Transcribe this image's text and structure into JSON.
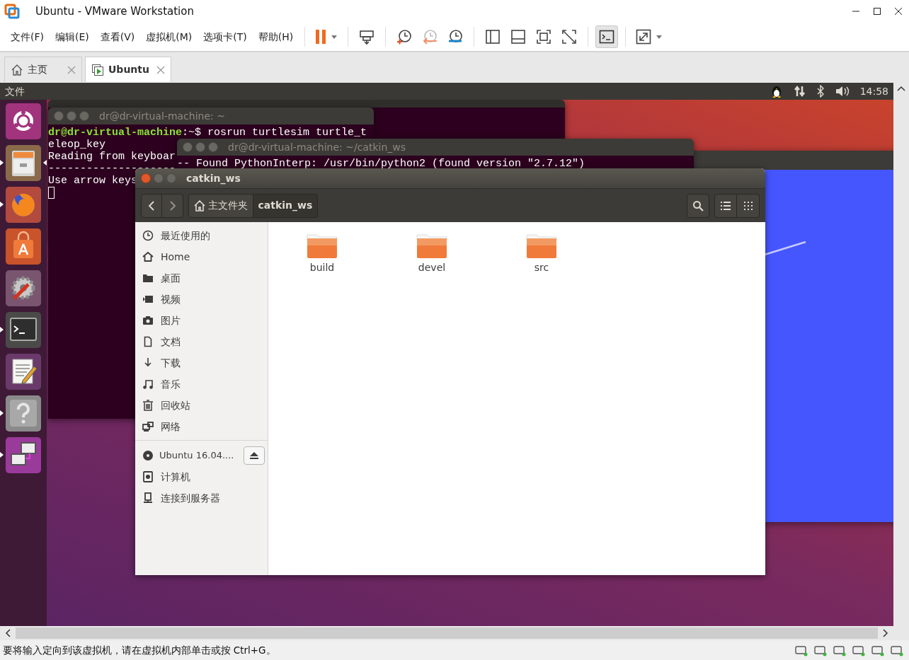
{
  "window": {
    "title": "Ubuntu - VMware Workstation"
  },
  "menu": [
    {
      "label": "文件(F)"
    },
    {
      "label": "编辑(E)"
    },
    {
      "label": "查看(V)"
    },
    {
      "label": "虚拟机(M)"
    },
    {
      "label": "选项卡(T)"
    },
    {
      "label": "帮助(H)"
    }
  ],
  "toolbar": [
    {
      "items": [
        {
          "kind": "pause",
          "pressed": false
        }
      ]
    },
    {
      "items": [
        {
          "kind": "send-keys",
          "pressed": false
        }
      ]
    },
    {
      "items": [
        {
          "kind": "snapshot",
          "pressed": false
        },
        {
          "kind": "revert",
          "pressed": false
        },
        {
          "kind": "manage-snapshots",
          "pressed": false
        }
      ]
    },
    {
      "items": [
        {
          "kind": "sidebar",
          "pressed": false
        },
        {
          "kind": "thumbnail",
          "pressed": false
        },
        {
          "kind": "full-screen",
          "pressed": false
        },
        {
          "kind": "unity",
          "pressed": false
        }
      ]
    },
    {
      "items": [
        {
          "kind": "console",
          "pressed": true
        }
      ]
    },
    {
      "items": [
        {
          "kind": "stretch",
          "pressed": false
        }
      ]
    }
  ],
  "tabs": [
    {
      "label": "主页",
      "kind": "home",
      "selected": false
    },
    {
      "label": "Ubuntu",
      "kind": "vm",
      "selected": true
    }
  ],
  "guest": {
    "top_panel": {
      "app_menu": "文件",
      "clock": "14:58"
    },
    "launcher": [
      {
        "kind": "dash",
        "running": false,
        "focused": false
      },
      {
        "kind": "files",
        "running": true,
        "focused": true
      },
      {
        "kind": "firefox",
        "running": true,
        "focused": false
      },
      {
        "kind": "software",
        "running": false,
        "focused": false
      },
      {
        "kind": "settings",
        "running": false,
        "focused": false
      },
      {
        "kind": "terminal",
        "running": true,
        "focused": false
      },
      {
        "kind": "editor",
        "running": false,
        "focused": false
      },
      {
        "kind": "help",
        "running": true,
        "focused": false
      },
      {
        "kind": "remote",
        "running": true,
        "focused": false
      }
    ],
    "terminal": {
      "title": "dr@dr-virtual-machine: ~",
      "lines": [
        {
          "kind": "prompt",
          "user_host": "dr@dr-virtual-machine",
          "rest": ":~$ rosrun turtlesim turtle_t"
        },
        {
          "kind": "output",
          "text": "eleop_key"
        },
        {
          "kind": "output",
          "text": "Reading from keyboar"
        },
        {
          "kind": "output",
          "text": "--------------------"
        },
        {
          "kind": "output",
          "text": "Use arrow keys"
        },
        {
          "kind": "cursor"
        }
      ]
    },
    "build_terminal": {
      "title": "dr@dr-virtual-machine: ~/catkin_ws",
      "lines": [
        "-- Found PythonInterp: /usr/bin/python2 (found version \"2.7.12\")"
      ]
    },
    "file_manager": {
      "title": "catkin_ws",
      "path": [
        {
          "label": "主文件夹",
          "kind": "home",
          "selected": false
        },
        {
          "label": "catkin_ws",
          "kind": "folder",
          "selected": true
        }
      ],
      "sidebar": [
        {
          "items": [
            {
              "label": "最近使用的",
              "kind": "recent",
              "ejectable": false
            },
            {
              "label": "Home",
              "kind": "home",
              "ejectable": false
            },
            {
              "label": "桌面",
              "kind": "folder",
              "ejectable": false
            },
            {
              "label": "视频",
              "kind": "video",
              "ejectable": false
            },
            {
              "label": "图片",
              "kind": "camera",
              "ejectable": false
            },
            {
              "label": "文档",
              "kind": "document",
              "ejectable": false
            },
            {
              "label": "下载",
              "kind": "download",
              "ejectable": false
            },
            {
              "label": "音乐",
              "kind": "music",
              "ejectable": false
            },
            {
              "label": "回收站",
              "kind": "trash",
              "ejectable": false
            },
            {
              "label": "网络",
              "kind": "network",
              "ejectable": false
            }
          ]
        },
        {
          "items": [
            {
              "label": "Ubuntu 16.04....",
              "kind": "disc",
              "ejectable": true
            },
            {
              "label": "计算机",
              "kind": "computer",
              "ejectable": false
            },
            {
              "label": "连接到服务器",
              "kind": "server",
              "ejectable": false
            }
          ]
        }
      ],
      "files": [
        {
          "name": "build"
        },
        {
          "name": "devel"
        },
        {
          "name": "src"
        }
      ]
    }
  },
  "status_bar": {
    "message": "要将输入定向到该虚拟机，请在虚拟机内部单击或按 Ctrl+G。"
  }
}
